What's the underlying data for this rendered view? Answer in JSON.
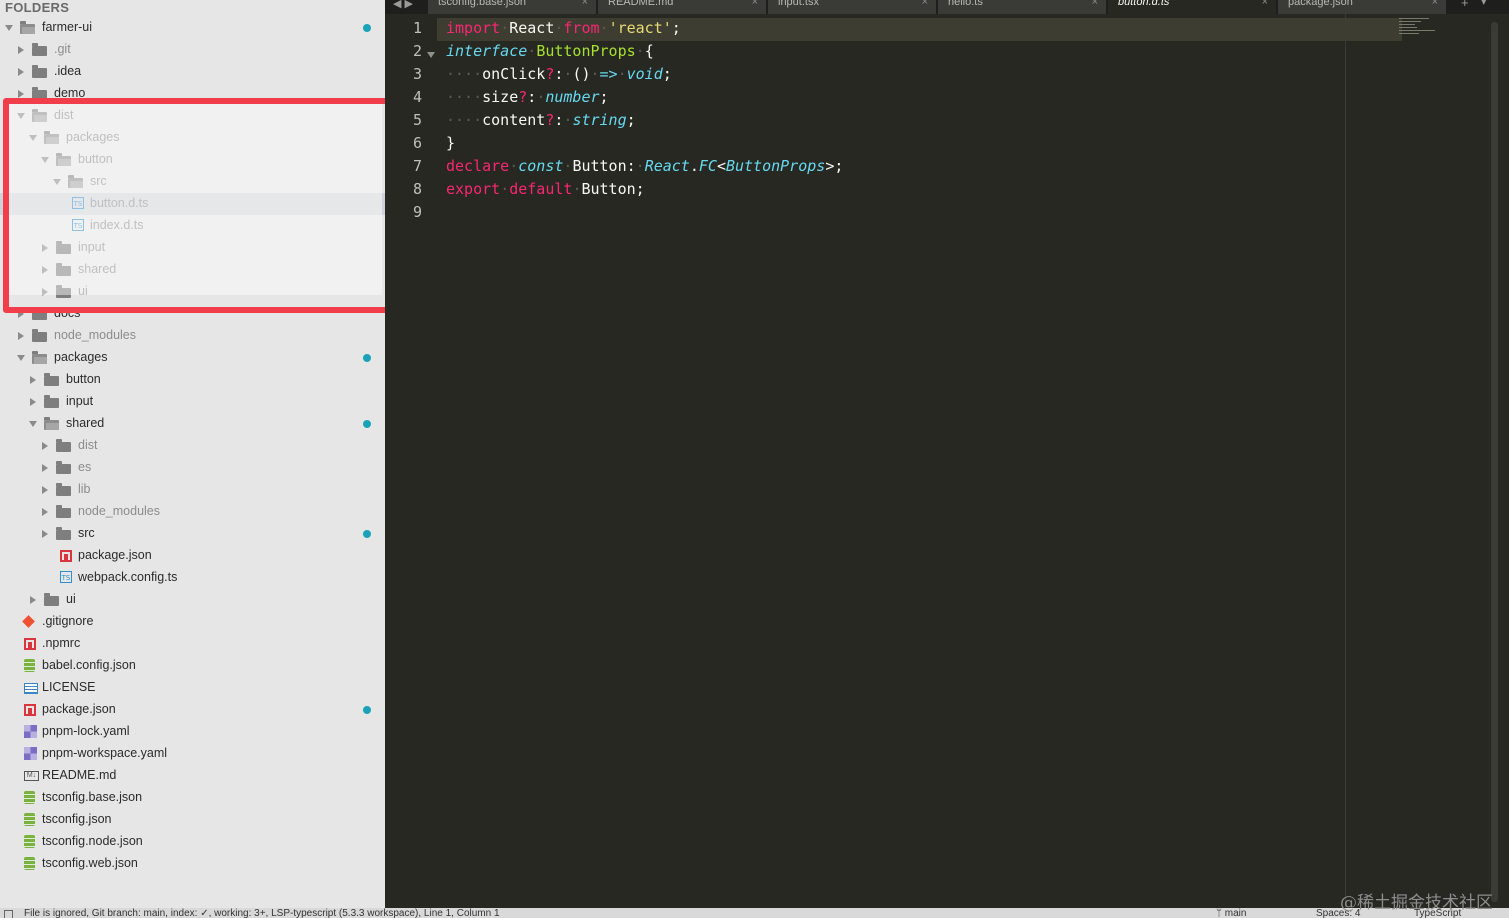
{
  "sidebar": {
    "heading": "FOLDERS",
    "tree": [
      {
        "label": "farmer-ui",
        "kind": "folder-open",
        "depth": 0,
        "dot": true
      },
      {
        "label": ".git",
        "kind": "folder",
        "depth": 1,
        "dim": true
      },
      {
        "label": ".idea",
        "kind": "folder",
        "depth": 1
      },
      {
        "label": "demo",
        "kind": "folder",
        "depth": 1
      },
      {
        "label": "dist",
        "kind": "folder-open",
        "depth": 1,
        "dim": true
      },
      {
        "label": "packages",
        "kind": "folder-open",
        "depth": 2,
        "dim": true
      },
      {
        "label": "button",
        "kind": "folder-open",
        "depth": 3,
        "dim": true
      },
      {
        "label": "src",
        "kind": "folder-open",
        "depth": 4,
        "dim": true
      },
      {
        "label": "button.d.ts",
        "kind": "ts",
        "depth": 5,
        "dim": true,
        "selected": true
      },
      {
        "label": "index.d.ts",
        "kind": "ts",
        "depth": 5,
        "dim": true
      },
      {
        "label": "input",
        "kind": "folder",
        "depth": 3,
        "dim": true
      },
      {
        "label": "shared",
        "kind": "folder",
        "depth": 3,
        "dim": true
      },
      {
        "label": "ui",
        "kind": "folder",
        "depth": 3,
        "dim": true
      },
      {
        "label": "docs",
        "kind": "folder",
        "depth": 1
      },
      {
        "label": "node_modules",
        "kind": "folder",
        "depth": 1,
        "dim": true
      },
      {
        "label": "packages",
        "kind": "folder-open",
        "depth": 1,
        "dot": true
      },
      {
        "label": "button",
        "kind": "folder",
        "depth": 2
      },
      {
        "label": "input",
        "kind": "folder",
        "depth": 2
      },
      {
        "label": "shared",
        "kind": "folder-open",
        "depth": 2,
        "dot": true
      },
      {
        "label": "dist",
        "kind": "folder",
        "depth": 3,
        "dim": true
      },
      {
        "label": "es",
        "kind": "folder",
        "depth": 3,
        "dim": true
      },
      {
        "label": "lib",
        "kind": "folder",
        "depth": 3,
        "dim": true
      },
      {
        "label": "node_modules",
        "kind": "folder",
        "depth": 3,
        "dim": true
      },
      {
        "label": "src",
        "kind": "folder",
        "depth": 3,
        "dot": true
      },
      {
        "label": "package.json",
        "kind": "npm",
        "depth": 4
      },
      {
        "label": "webpack.config.ts",
        "kind": "ts",
        "depth": 4
      },
      {
        "label": "ui",
        "kind": "folder",
        "depth": 2
      },
      {
        "label": ".gitignore",
        "kind": "git",
        "depth": 1
      },
      {
        "label": ".npmrc",
        "kind": "npm",
        "depth": 1
      },
      {
        "label": "babel.config.json",
        "kind": "json",
        "depth": 1
      },
      {
        "label": "LICENSE",
        "kind": "license",
        "depth": 1
      },
      {
        "label": "package.json",
        "kind": "npm",
        "depth": 1,
        "dot": true
      },
      {
        "label": "pnpm-lock.yaml",
        "kind": "yaml",
        "depth": 1
      },
      {
        "label": "pnpm-workspace.yaml",
        "kind": "yaml",
        "depth": 1
      },
      {
        "label": "README.md",
        "kind": "md",
        "depth": 1
      },
      {
        "label": "tsconfig.base.json",
        "kind": "json",
        "depth": 1
      },
      {
        "label": "tsconfig.json",
        "kind": "json",
        "depth": 1
      },
      {
        "label": "tsconfig.node.json",
        "kind": "json",
        "depth": 1
      },
      {
        "label": "tsconfig.web.json",
        "kind": "json",
        "depth": 1
      }
    ]
  },
  "tabs": [
    {
      "label": "tsconfig.base.json",
      "close": "×",
      "active": false
    },
    {
      "label": "README.md",
      "close": "×",
      "active": false
    },
    {
      "label": "input.tsx",
      "close": "×",
      "active": false
    },
    {
      "label": "hello.ts",
      "close": "×",
      "active": false
    },
    {
      "label": "button.d.ts",
      "close": "×",
      "active": true
    },
    {
      "label": "package.json",
      "close": "×",
      "active": false
    }
  ],
  "tabbar": {
    "nav": "◀ ▶",
    "plus": "+",
    "menu": "▾"
  },
  "editor": {
    "line_numbers": [
      "1",
      "2",
      "3",
      "4",
      "5",
      "6",
      "7",
      "8",
      "9"
    ],
    "lines": [
      [
        {
          "t": "import",
          "c": "kw"
        },
        {
          "t": "·",
          "c": "ws"
        },
        {
          "t": "React",
          "c": ""
        },
        {
          "t": "·",
          "c": "ws"
        },
        {
          "t": "from",
          "c": "kw"
        },
        {
          "t": "·",
          "c": "ws"
        },
        {
          "t": "'react'",
          "c": "str"
        },
        {
          "t": ";",
          "c": ""
        }
      ],
      [
        {
          "t": "interface",
          "c": "ty"
        },
        {
          "t": "·",
          "c": "ws"
        },
        {
          "t": "ButtonProps",
          "c": "cls"
        },
        {
          "t": "·",
          "c": "ws"
        },
        {
          "t": "{",
          "c": ""
        }
      ],
      [
        {
          "t": "····",
          "c": "ws"
        },
        {
          "t": "onClick",
          "c": ""
        },
        {
          "t": "?",
          "c": "kw"
        },
        {
          "t": ":",
          "c": ""
        },
        {
          "t": "·",
          "c": "ws"
        },
        {
          "t": "()",
          "c": ""
        },
        {
          "t": "·",
          "c": "ws"
        },
        {
          "t": "=>",
          "c": "ty"
        },
        {
          "t": "·",
          "c": "ws"
        },
        {
          "t": "void",
          "c": "ty"
        },
        {
          "t": ";",
          "c": ""
        }
      ],
      [
        {
          "t": "····",
          "c": "ws"
        },
        {
          "t": "size",
          "c": ""
        },
        {
          "t": "?",
          "c": "kw"
        },
        {
          "t": ":",
          "c": ""
        },
        {
          "t": "·",
          "c": "ws"
        },
        {
          "t": "number",
          "c": "ty"
        },
        {
          "t": ";",
          "c": ""
        }
      ],
      [
        {
          "t": "····",
          "c": "ws"
        },
        {
          "t": "content",
          "c": ""
        },
        {
          "t": "?",
          "c": "kw"
        },
        {
          "t": ":",
          "c": ""
        },
        {
          "t": "·",
          "c": "ws"
        },
        {
          "t": "string",
          "c": "ty"
        },
        {
          "t": ";",
          "c": ""
        }
      ],
      [
        {
          "t": "}",
          "c": ""
        }
      ],
      [
        {
          "t": "declare",
          "c": "kw"
        },
        {
          "t": "·",
          "c": "ws"
        },
        {
          "t": "const",
          "c": "ty"
        },
        {
          "t": "·",
          "c": "ws"
        },
        {
          "t": "Button",
          "c": ""
        },
        {
          "t": ":",
          "c": ""
        },
        {
          "t": "·",
          "c": "ws"
        },
        {
          "t": "React",
          "c": "ty"
        },
        {
          "t": ".",
          "c": ""
        },
        {
          "t": "FC",
          "c": "ty"
        },
        {
          "t": "<",
          "c": ""
        },
        {
          "t": "ButtonProps",
          "c": "ty"
        },
        {
          "t": ">;",
          "c": ""
        }
      ],
      [
        {
          "t": "export",
          "c": "kw"
        },
        {
          "t": "·",
          "c": "ws"
        },
        {
          "t": "default",
          "c": "kw"
        },
        {
          "t": "·",
          "c": "ws"
        },
        {
          "t": "Button",
          "c": ""
        },
        {
          "t": ";",
          "c": ""
        }
      ],
      []
    ]
  },
  "statusbar": {
    "left": "File is ignored, Git branch: main, index: ✓, working: 3+, LSP-typescript (5.3.3 workspace), Line 1, Column 1",
    "branch": "ᛘ main",
    "spaces": "Spaces: 4",
    "syntax": "TypeScript"
  },
  "watermark": "@稀土掘金技术社区",
  "colors": {
    "accent_dot": "#1aa3b8",
    "highlight_box": "#f23e4a",
    "editor_bg": "#272822"
  }
}
